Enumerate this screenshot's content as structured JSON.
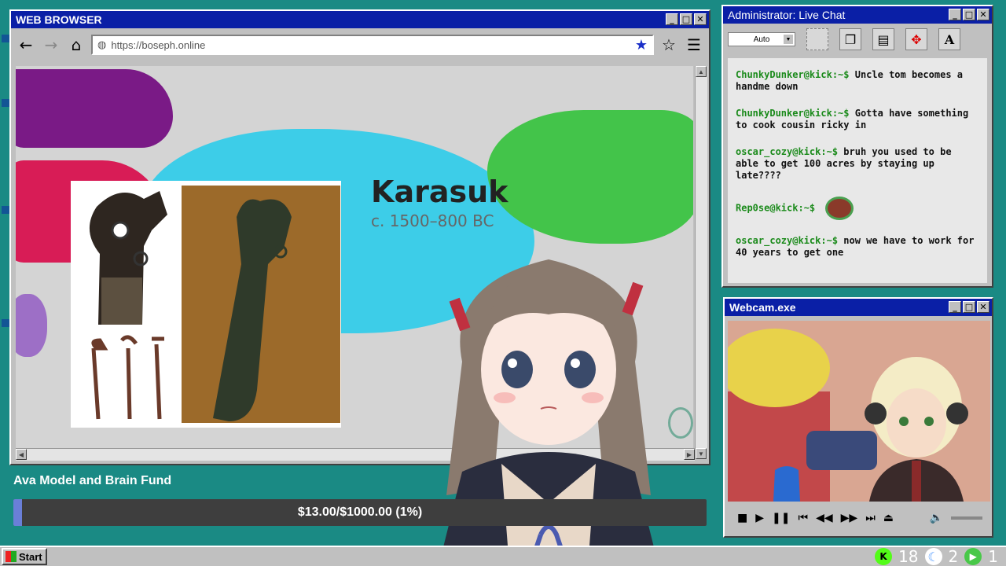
{
  "browser": {
    "title": "WEB BROWSER",
    "url": "https://boseph.online",
    "slide": {
      "title": "Karasuk",
      "subtitle": "c. 1500–800 BC"
    }
  },
  "chat": {
    "title": "Administrator: Live Chat",
    "font_select": "Auto",
    "messages": [
      {
        "user": "ChunkyDunker@kick:~$",
        "text": "Uncle tom becomes a handme down"
      },
      {
        "user": "ChunkyDunker@kick:~$",
        "text": "Gotta have something to cook cousin ricky in"
      },
      {
        "user": "oscar_cozy@kick:~$",
        "text": "bruh you used to be able to get 100 acres by staying up late????"
      },
      {
        "user": "Rep0se@kick:~$",
        "text": ""
      },
      {
        "user": "oscar_cozy@kick:~$",
        "text": "now we have to work for 40 years to get one"
      }
    ]
  },
  "webcam": {
    "title": "Webcam.exe"
  },
  "fund": {
    "title": "Ava Model and Brain Fund",
    "amount_text": "$13.00/$1000.00 (1%)",
    "progress_percent": 1.3
  },
  "taskbar": {
    "start_label": "Start",
    "tray": [
      {
        "icon": "kick-icon",
        "count": "18",
        "color": "#53fc18"
      },
      {
        "icon": "moon-icon",
        "count": "2",
        "color": "#5aa0ff"
      },
      {
        "icon": "play-icon",
        "count": "1",
        "color": "#48c848"
      }
    ]
  },
  "colors": {
    "desktop": "#1a8a84",
    "titlebar": "#0a1fa6",
    "chat_user": "#1a8a1a"
  }
}
